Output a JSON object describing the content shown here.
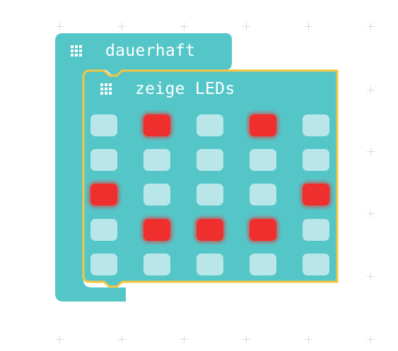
{
  "workspace": {
    "background": "#ffffff",
    "grid_marker_color": "#d6dbde"
  },
  "forever_block": {
    "label": "dauerhaft",
    "icon": "led-grid-icon",
    "color": "#55c6c8"
  },
  "show_leds_block": {
    "label": "zeige LEDs",
    "icon": "led-grid-icon",
    "color": "#55c6c8",
    "selected_outline_color": "#f5c542",
    "led_on_color": "#ef2e2e",
    "led_off_color": "#b9e6e8",
    "matrix": [
      [
        0,
        1,
        0,
        1,
        0
      ],
      [
        0,
        0,
        0,
        0,
        0
      ],
      [
        1,
        0,
        0,
        0,
        1
      ],
      [
        0,
        1,
        1,
        1,
        0
      ],
      [
        0,
        0,
        0,
        0,
        0
      ]
    ]
  }
}
